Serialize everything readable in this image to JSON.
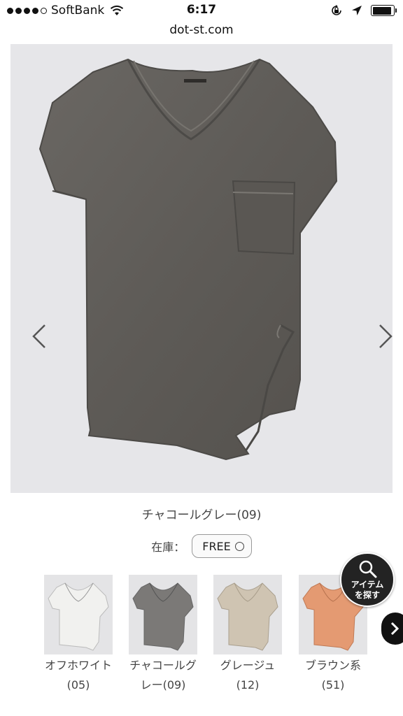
{
  "status_bar": {
    "carrier": "SoftBank",
    "time": "6:17",
    "battery_level": 0.9
  },
  "browser": {
    "url": "dot-st.com"
  },
  "product": {
    "color_name": "チャコールグレー(09)",
    "stock_label": "在庫：",
    "size": "FREE"
  },
  "color_variants": [
    {
      "name": "オフホワイト",
      "code": "(05)",
      "color": "#f1f1ef"
    },
    {
      "name": "チャコールグ",
      "name2": "レー",
      "code": "(09)",
      "color": "#7b7977"
    },
    {
      "name": "グレージュ",
      "code": "(12)",
      "color": "#cfc4b2"
    },
    {
      "name": "ブラウン系",
      "code": "(51)",
      "color": "#e49a72"
    }
  ],
  "search_fab": {
    "line1": "アイテム",
    "line2": "を探す"
  },
  "icons": {
    "prev": "chevron-left-icon",
    "next": "chevron-right-icon",
    "search": "magnifier-icon"
  }
}
